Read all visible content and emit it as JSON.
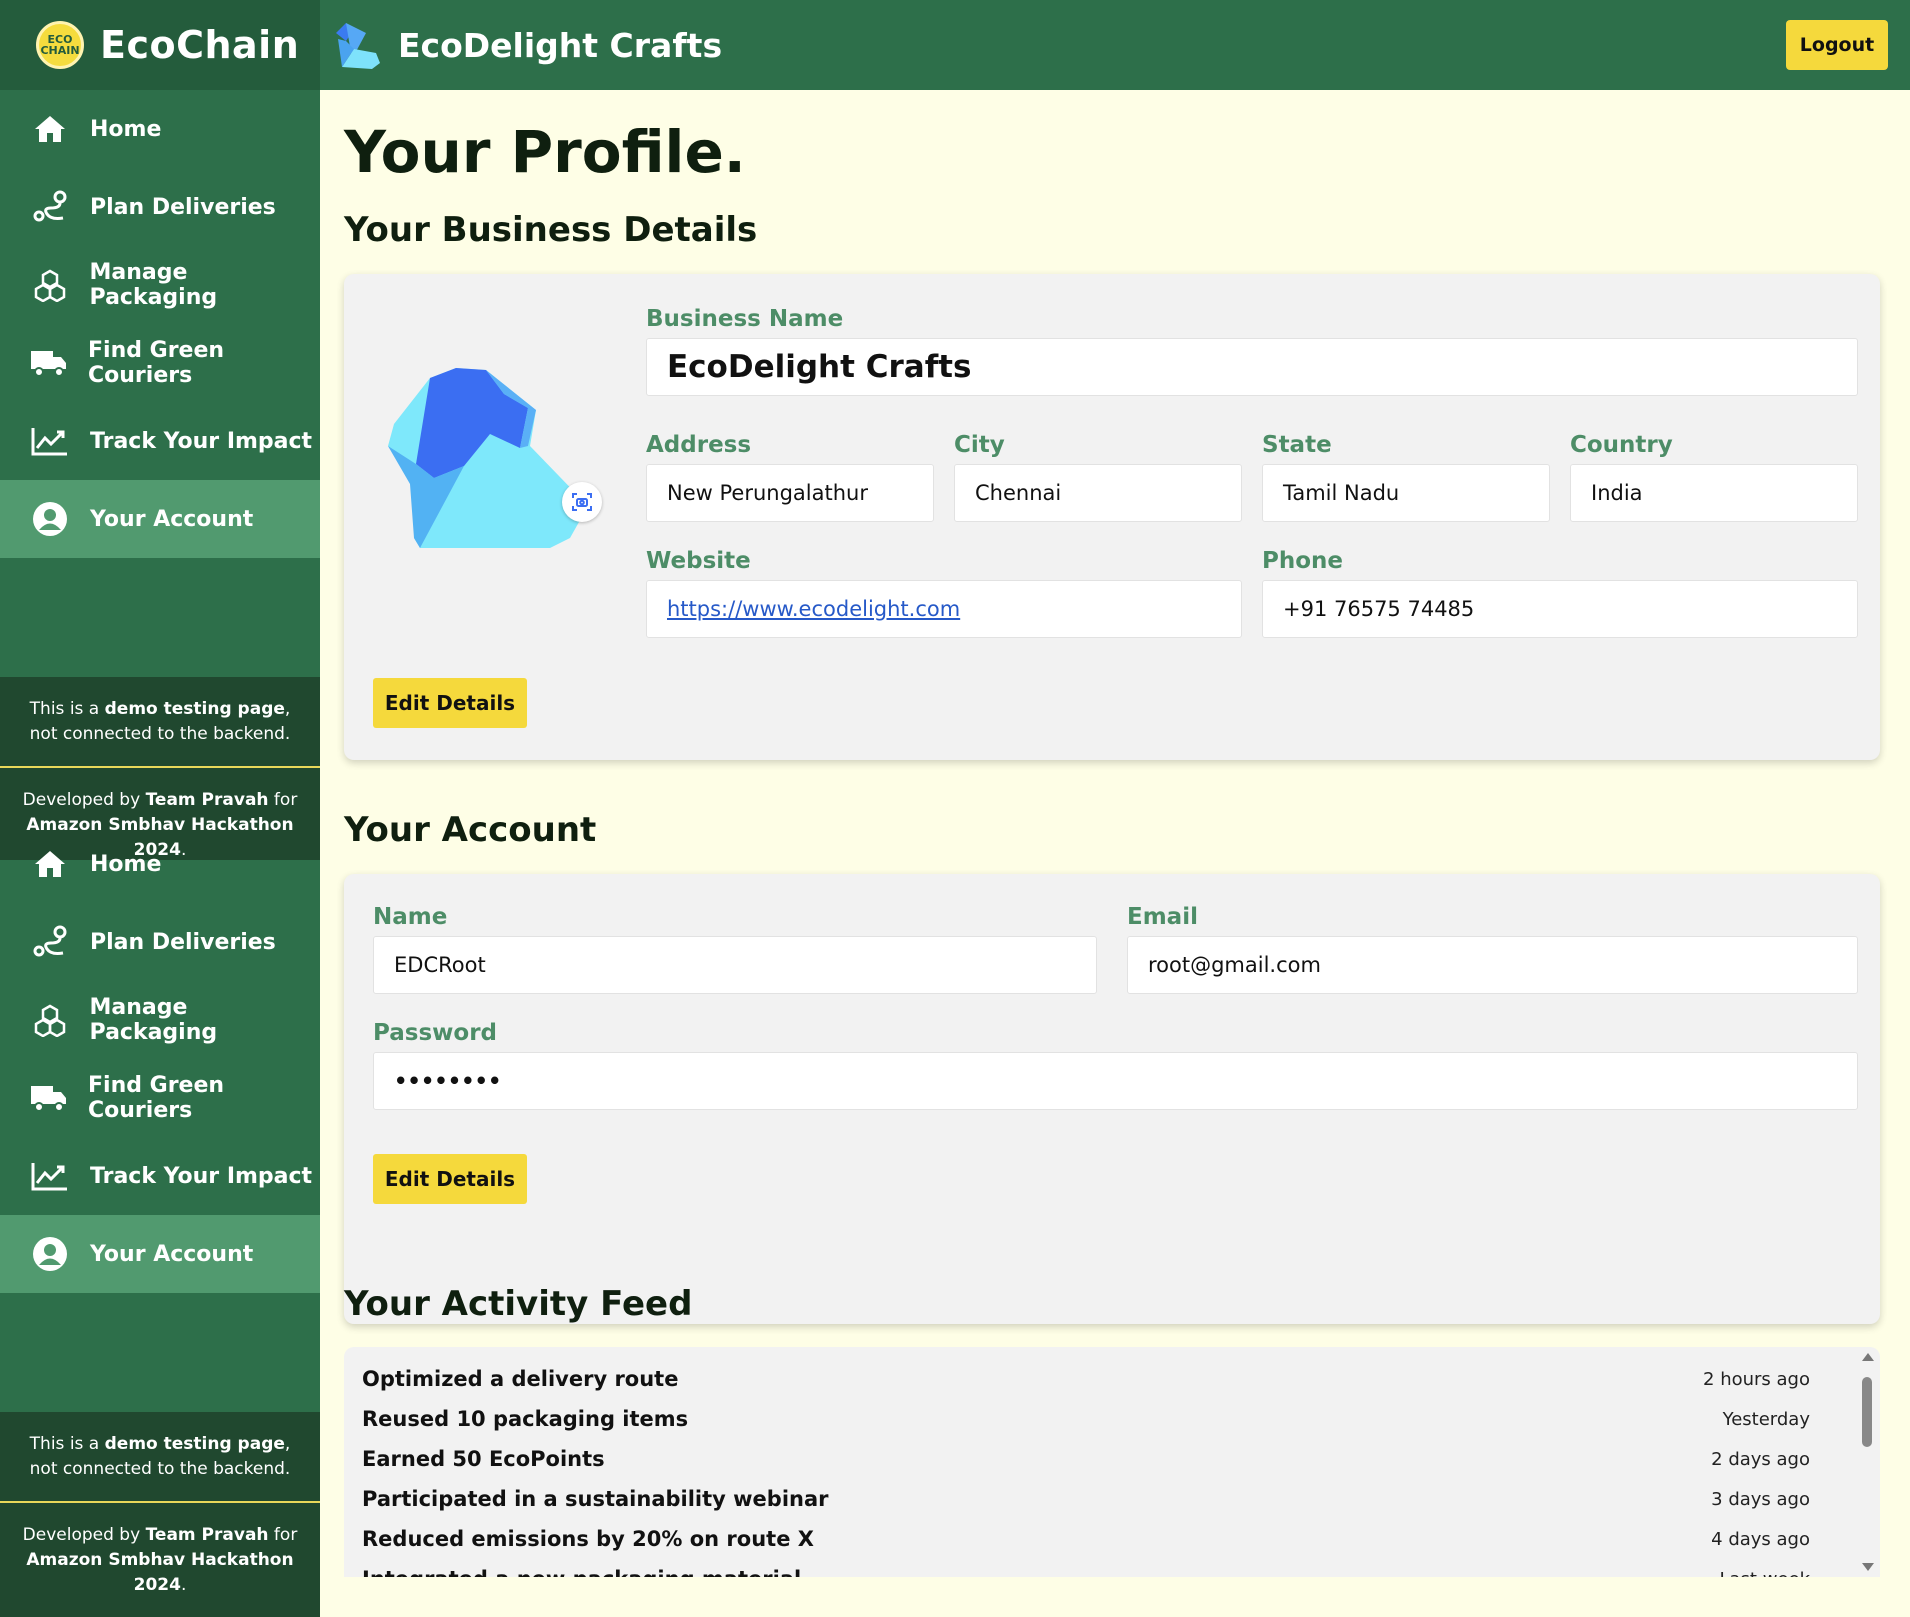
{
  "brand": {
    "name": "EcoChain",
    "logo_text": "ECO CHAIN"
  },
  "header": {
    "business": "EcoDelight Crafts",
    "logout": "Logout"
  },
  "nav": [
    {
      "label": "Home",
      "icon": "home-icon"
    },
    {
      "label": "Plan Deliveries",
      "icon": "route-icon"
    },
    {
      "label": "Manage Packaging",
      "icon": "boxes-icon"
    },
    {
      "label": "Find Green Couriers",
      "icon": "truck-icon"
    },
    {
      "label": "Track Your Impact",
      "icon": "chart-icon"
    },
    {
      "label": "Your Account",
      "icon": "user-icon",
      "active": true
    }
  ],
  "note": {
    "demo_pre": "This is a ",
    "demo_bold": "demo testing page",
    "demo_post": ", not connected to the backend.",
    "dev_pre": "Developed by ",
    "dev_team": "Team Pravah",
    "dev_for": " for ",
    "dev_event": "Amazon Smbhav Hackathon 2024",
    "dev_end": "."
  },
  "page": {
    "title": "Your Profile."
  },
  "business": {
    "section_title": "Your Business Details",
    "labels": {
      "name": "Business Name",
      "address": "Address",
      "city": "City",
      "state": "State",
      "country": "Country",
      "website": "Website",
      "phone": "Phone"
    },
    "values": {
      "name": "EcoDelight Crafts",
      "address": "New Perungalathur",
      "city": "Chennai",
      "state": "Tamil Nadu",
      "country": "India",
      "website": "https://www.ecodelight.com",
      "phone": "+91 76575 74485"
    },
    "edit": "Edit Details"
  },
  "account": {
    "section_title": "Your Account",
    "labels": {
      "name": "Name",
      "email": "Email",
      "password": "Password"
    },
    "values": {
      "name": "EDCRoot",
      "email": "root@gmail.com",
      "password": "••••••••"
    },
    "edit": "Edit Details"
  },
  "activity": {
    "section_title": "Your Activity Feed",
    "items": [
      {
        "text": "Optimized a delivery route",
        "time": "2 hours ago"
      },
      {
        "text": "Reused 10 packaging items",
        "time": "Yesterday"
      },
      {
        "text": "Earned 50 EcoPoints",
        "time": "2 days ago"
      },
      {
        "text": "Participated in a sustainability webinar",
        "time": "3 days ago"
      },
      {
        "text": "Reduced emissions by 20% on route X",
        "time": "4 days ago"
      },
      {
        "text": "Integrated a new packaging material",
        "time": "Last week"
      }
    ]
  },
  "colors": {
    "primary": "#2d6f4a",
    "active": "#519a6f",
    "accent": "#f5d93c",
    "background": "#fefee6",
    "label": "#4d8d67"
  }
}
